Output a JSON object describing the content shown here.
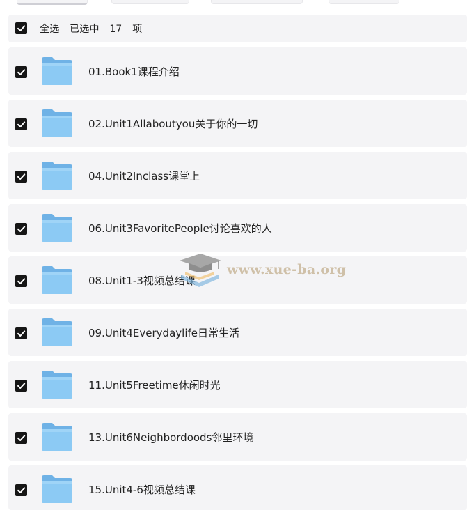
{
  "selection_bar": {
    "select_all_label": "全选",
    "selected_prefix": "已选中",
    "selected_count": "17",
    "selected_unit": "项"
  },
  "folders": [
    {
      "name": "01.Book1课程介绍",
      "checked": true
    },
    {
      "name": "02.Unit1Allaboutyou关于你的一切",
      "checked": true
    },
    {
      "name": "04.Unit2Inclass课堂上",
      "checked": true
    },
    {
      "name": "06.Unit3FavoritePeople讨论喜欢的人",
      "checked": true
    },
    {
      "name": "08.Unit1-3视频总结课",
      "checked": true
    },
    {
      "name": "09.Unit4Everydaylife日常生活",
      "checked": true
    },
    {
      "name": "11.Unit5Freetime休闲时光",
      "checked": true
    },
    {
      "name": "13.Unit6Neighbordoods邻里环境",
      "checked": true
    },
    {
      "name": "15.Unit4-6视频总结课",
      "checked": true
    }
  ],
  "icons": {
    "folder": "folder-icon",
    "check": "check-icon"
  },
  "colors": {
    "folder_top": "#6fb2e6",
    "folder_body": "#8ccaf4",
    "checkbox": "#161616",
    "row_bg": "#f4f4f6"
  },
  "watermark": {
    "text": "www.xue-ba.org"
  }
}
